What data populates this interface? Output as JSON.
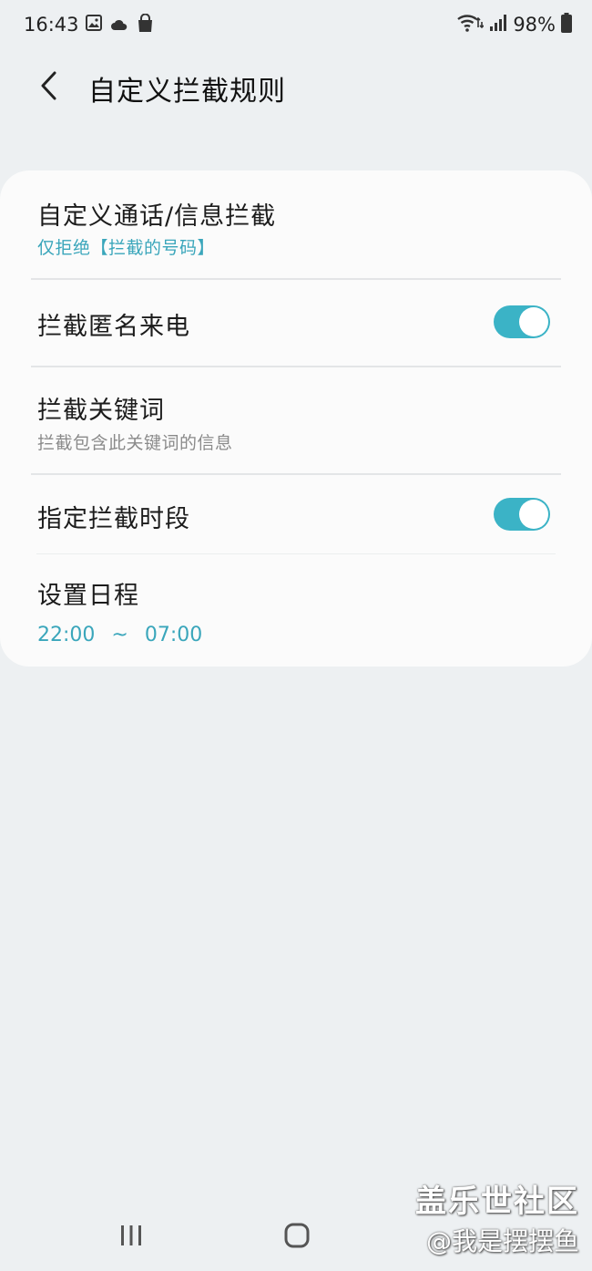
{
  "status_bar": {
    "time": "16:43",
    "battery": "98%",
    "icons_left": [
      "gallery-icon",
      "cloud-icon",
      "shopping-bag-icon"
    ],
    "icons_right": [
      "wifi-icon",
      "signal-icon",
      "battery-icon"
    ]
  },
  "header": {
    "title": "自定义拦截规则",
    "back_icon": "back-arrow-icon"
  },
  "settings": {
    "custom_block": {
      "title": "自定义通话/信息拦截",
      "subtitle": "仅拒绝【拦截的号码】"
    },
    "block_anonymous": {
      "title": "拦截匿名来电",
      "enabled": true
    },
    "block_keywords": {
      "title": "拦截关键词",
      "subtitle": "拦截包含此关键词的信息"
    },
    "scheduled_block": {
      "title": "指定拦截时段",
      "enabled": true
    },
    "schedule": {
      "title": "设置日程",
      "start": "22:00",
      "separator": "~",
      "end": "07:00"
    }
  },
  "nav": {
    "recents_icon": "recent-apps-icon",
    "home_icon": "home-icon"
  },
  "watermark": {
    "line1": "盖乐世社区",
    "line2": "@我是摆摆鱼"
  },
  "colors": {
    "accent": "#3bb3c6",
    "background": "#edf0f2",
    "card": "#fbfbfb"
  }
}
